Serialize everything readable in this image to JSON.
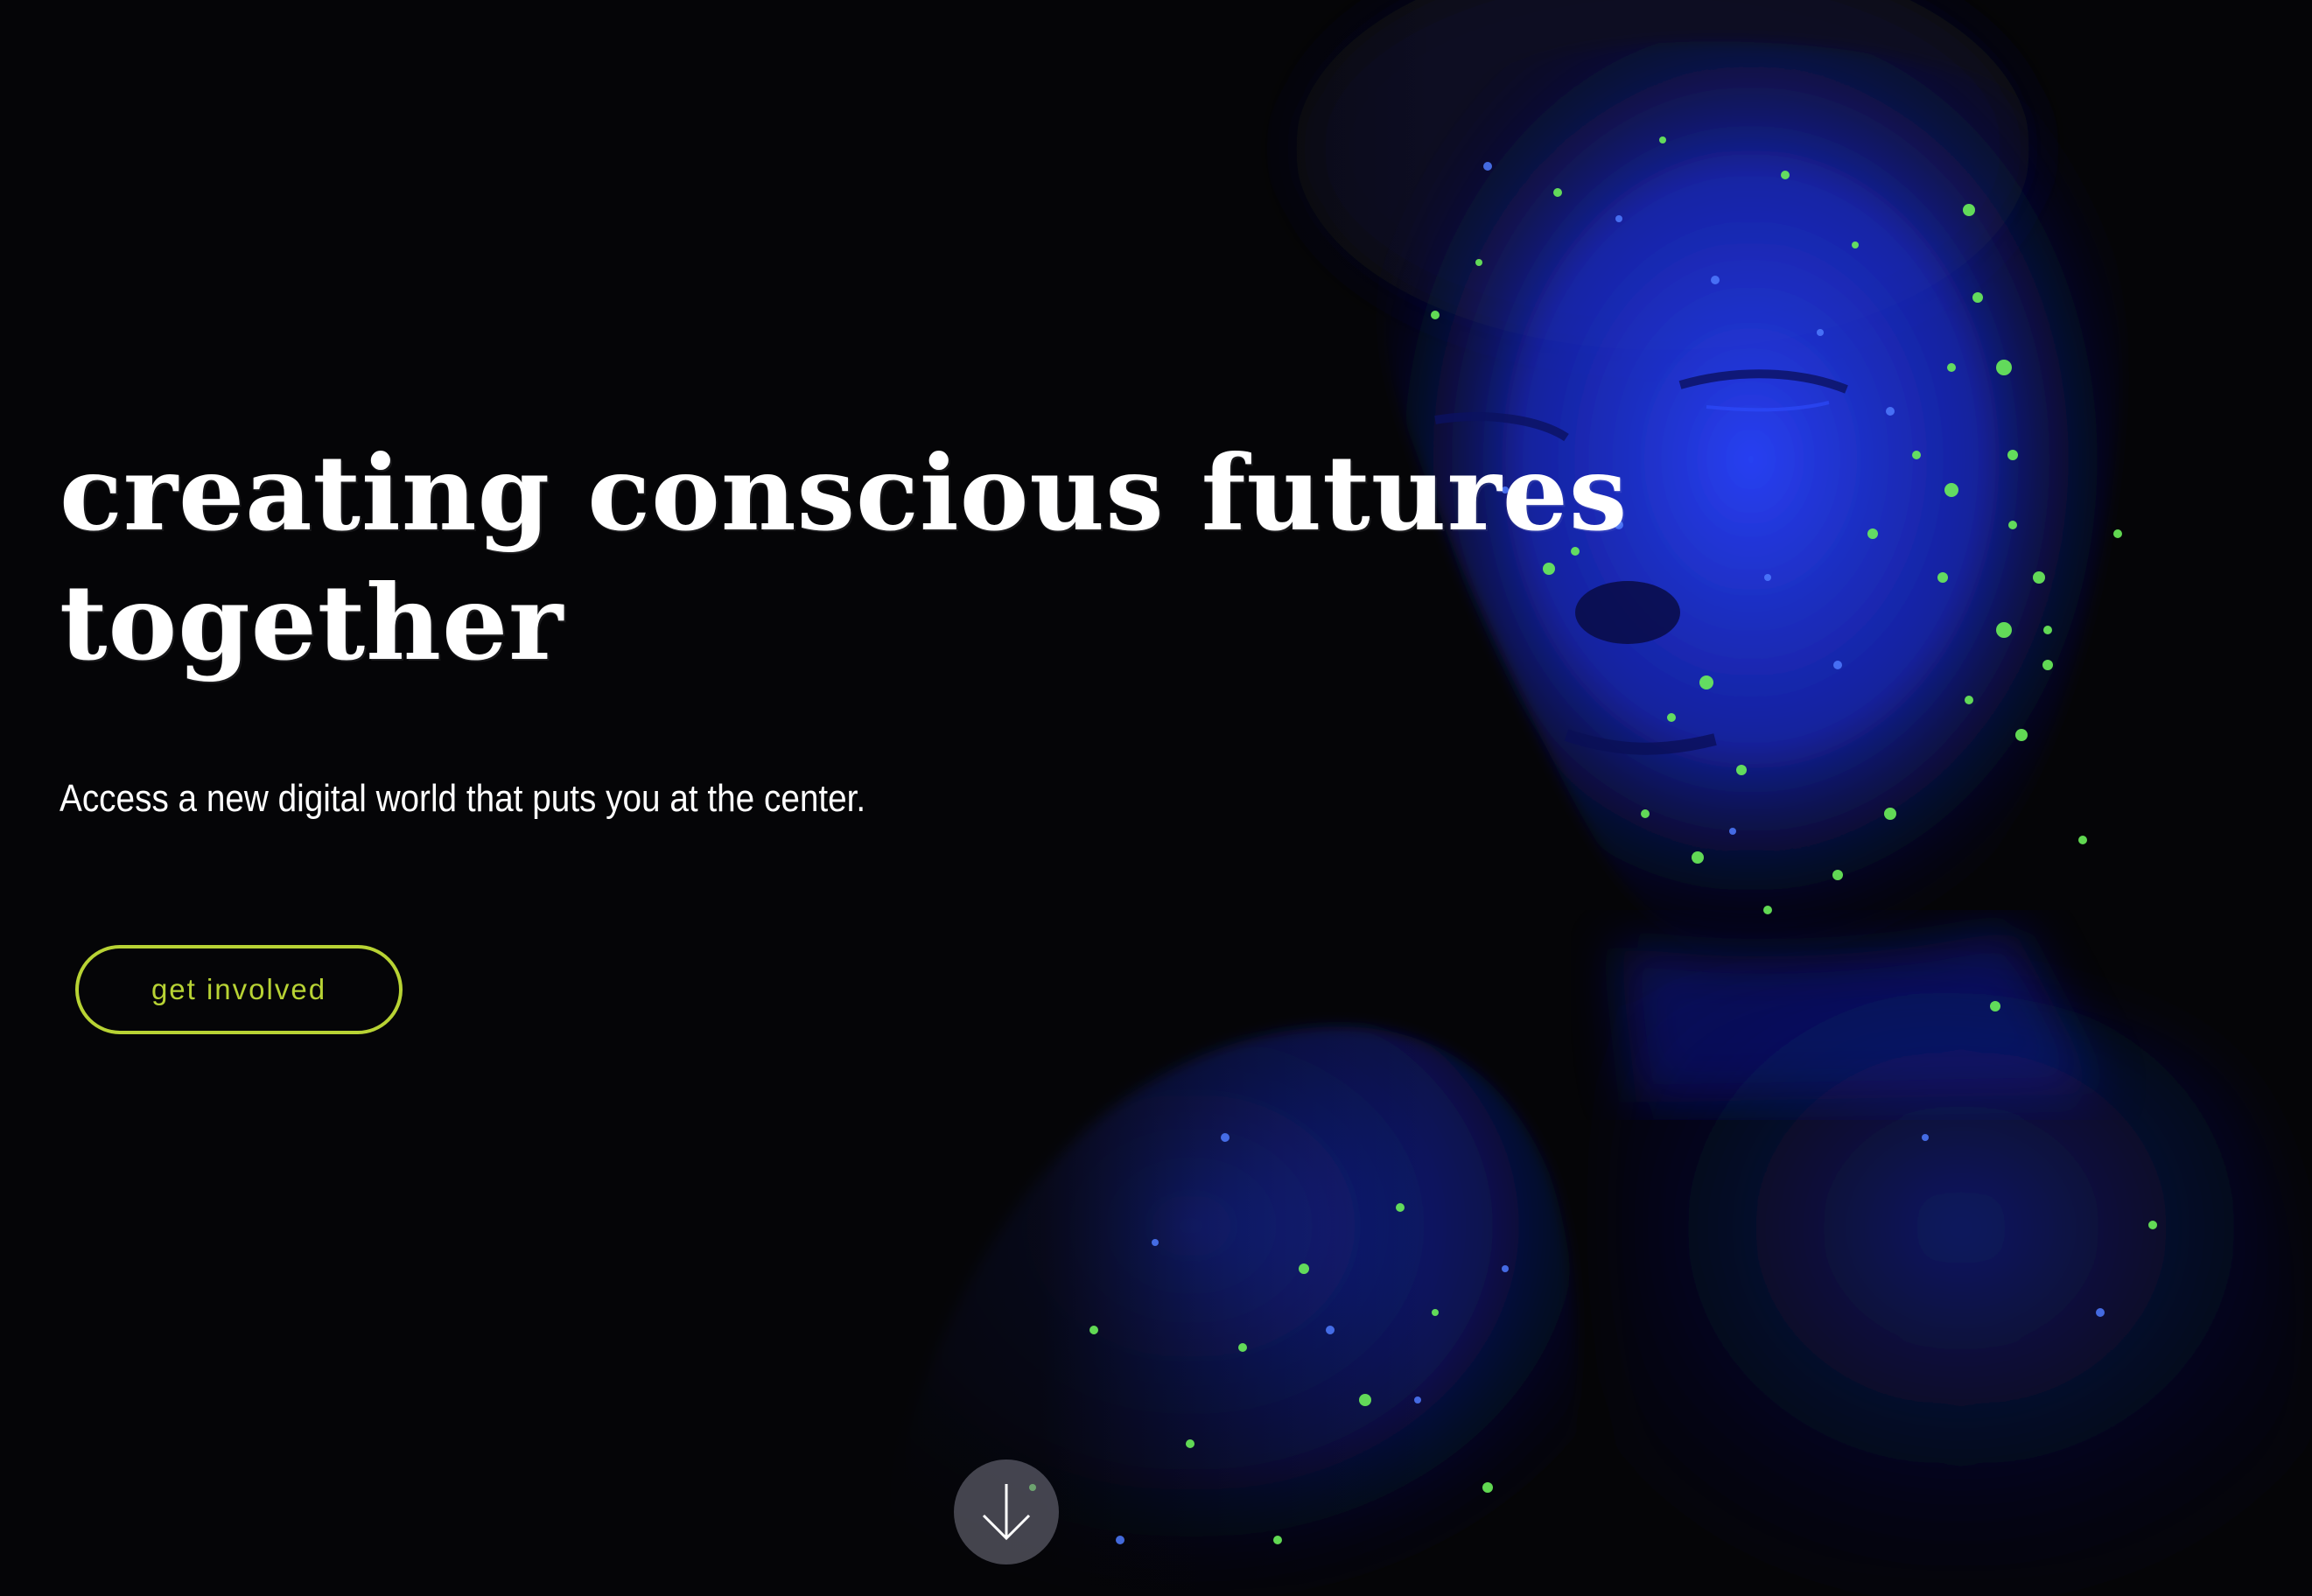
{
  "hero": {
    "headline_line1": "creating conscious futures",
    "headline_line2": "together",
    "subheadline": "Access a new digital world that puts you at the center.",
    "cta_label": "get involved"
  },
  "icons": {
    "scroll": "arrow-down-icon"
  },
  "colors": {
    "background": "#050507",
    "text": "#ffffff",
    "accent": "#b8d334",
    "uv_blue": "#1d3cff",
    "uv_green": "#6cf05a"
  }
}
